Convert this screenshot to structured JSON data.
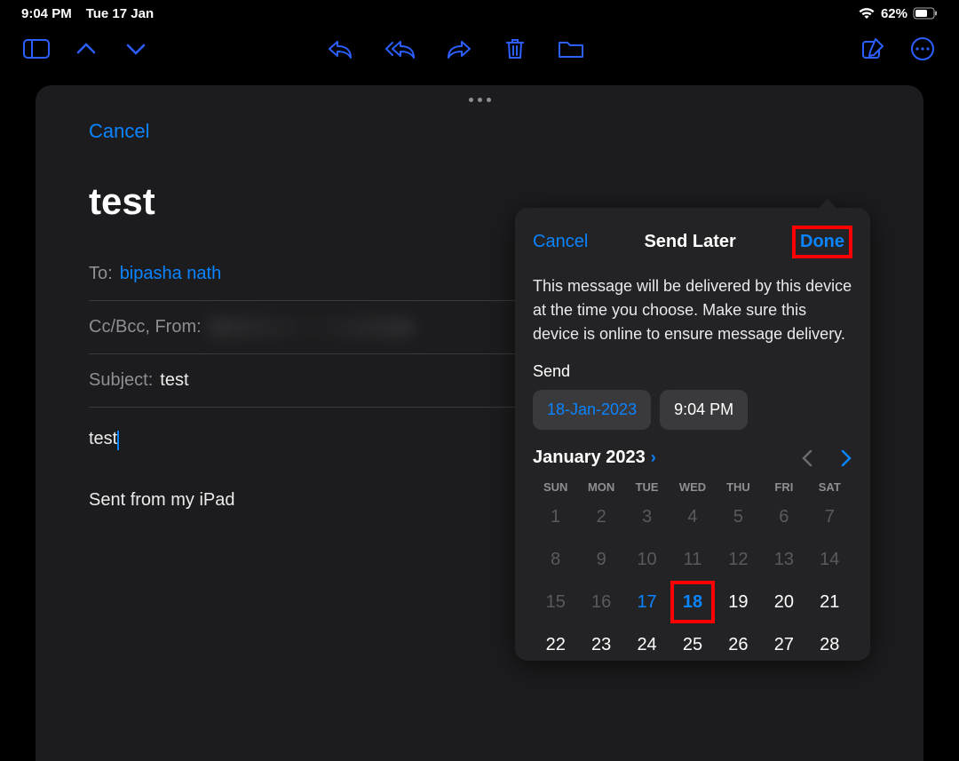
{
  "status": {
    "time": "9:04 PM",
    "date": "Tue 17 Jan",
    "battery": "62%"
  },
  "compose": {
    "cancel": "Cancel",
    "title": "test",
    "to_label": "To:",
    "to_value": "bipasha nath",
    "cc_label": "Cc/Bcc, From:",
    "subject_label": "Subject:",
    "subject_value": "test",
    "body": "test",
    "signature": "Sent from my iPad"
  },
  "popover": {
    "cancel": "Cancel",
    "title": "Send Later",
    "done": "Done",
    "description": "This message will be delivered by this device at the time you choose. Make sure this device is online to ensure message delivery.",
    "send_label": "Send",
    "date_value": "18-Jan-2023",
    "time_value": "9:04 PM",
    "month_label": "January 2023",
    "weekdays": [
      "SUN",
      "MON",
      "TUE",
      "WED",
      "THU",
      "FRI",
      "SAT"
    ],
    "days": [
      {
        "n": "1",
        "dim": true
      },
      {
        "n": "2",
        "dim": true
      },
      {
        "n": "3",
        "dim": true
      },
      {
        "n": "4",
        "dim": true
      },
      {
        "n": "5",
        "dim": true
      },
      {
        "n": "6",
        "dim": true
      },
      {
        "n": "7",
        "dim": true
      },
      {
        "n": "8",
        "dim": true
      },
      {
        "n": "9",
        "dim": true
      },
      {
        "n": "10",
        "dim": true
      },
      {
        "n": "11",
        "dim": true
      },
      {
        "n": "12",
        "dim": true
      },
      {
        "n": "13",
        "dim": true
      },
      {
        "n": "14",
        "dim": true
      },
      {
        "n": "15",
        "dim": true
      },
      {
        "n": "16",
        "dim": true
      },
      {
        "n": "17",
        "today": true
      },
      {
        "n": "18",
        "selected": true
      },
      {
        "n": "19"
      },
      {
        "n": "20"
      },
      {
        "n": "21"
      },
      {
        "n": "22"
      },
      {
        "n": "23"
      },
      {
        "n": "24"
      },
      {
        "n": "25"
      },
      {
        "n": "26"
      },
      {
        "n": "27"
      },
      {
        "n": "28"
      }
    ]
  }
}
